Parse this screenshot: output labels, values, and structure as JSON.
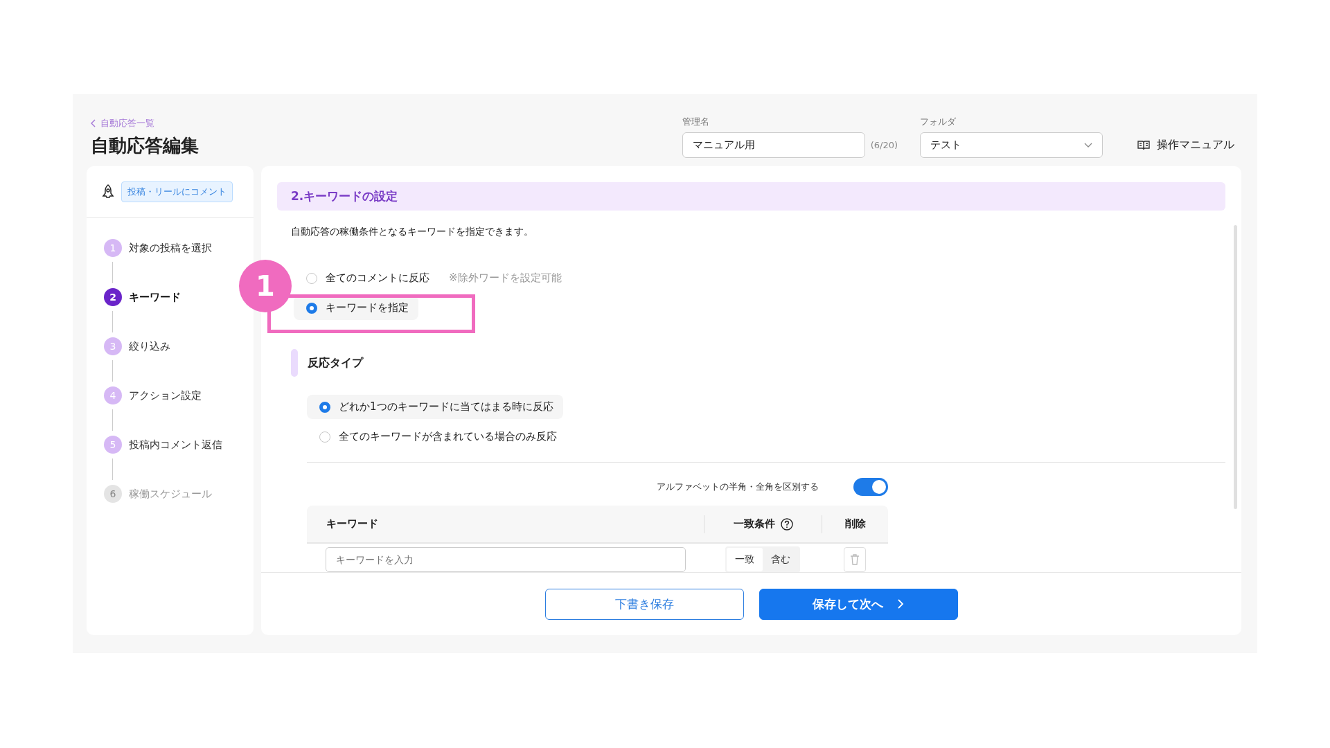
{
  "breadcrumb": {
    "label": "自動応答一覧"
  },
  "page_title": "自動応答編集",
  "management_name": {
    "label": "管理名",
    "value": "マニュアル用",
    "counter": "(6/20)"
  },
  "folder": {
    "label": "フォルダ",
    "value": "テスト"
  },
  "manual_link": "操作マニュアル",
  "sidebar": {
    "trigger_tag": "投稿・リールにコメント",
    "steps": [
      {
        "number": "1",
        "label": "対象の投稿を選択",
        "selected": false,
        "disabled": false
      },
      {
        "number": "2",
        "label": "キーワード",
        "selected": true,
        "disabled": false
      },
      {
        "number": "3",
        "label": "絞り込み",
        "selected": false,
        "disabled": false
      },
      {
        "number": "4",
        "label": "アクション設定",
        "selected": false,
        "disabled": false
      },
      {
        "number": "5",
        "label": "投稿内コメント返信",
        "selected": false,
        "disabled": false
      },
      {
        "number": "6",
        "label": "稼働スケジュール",
        "selected": false,
        "disabled": true
      }
    ]
  },
  "section": {
    "title": "2.キーワードの設定",
    "description": "自動応答の稼働条件となるキーワードを指定できます。",
    "trigger_options": [
      {
        "label": "全てのコメントに反応",
        "note": "※除外ワードを設定可能",
        "selected": false
      },
      {
        "label": "キーワードを指定",
        "selected": true
      }
    ],
    "reaction_type": {
      "title": "反応タイプ",
      "options": [
        {
          "label": "どれか1つのキーワードに当てはまる時に反応",
          "selected": true
        },
        {
          "label": "全てのキーワードが含まれている場合のみ反応",
          "selected": false
        }
      ]
    },
    "width_toggle": {
      "label": "アルファベットの半角・全角を区別する",
      "on": true
    },
    "keyword_table": {
      "columns": [
        "キーワード",
        "一致条件",
        "削除"
      ],
      "rows": [
        {
          "placeholder": "キーワードを入力",
          "match_options": [
            {
              "label": "一致",
              "selected": true
            },
            {
              "label": "含む",
              "selected": false
            }
          ]
        }
      ]
    }
  },
  "footer": {
    "draft_button": "下書き保存",
    "save_button": "保存して次へ"
  },
  "annotation": {
    "number": "1"
  }
}
